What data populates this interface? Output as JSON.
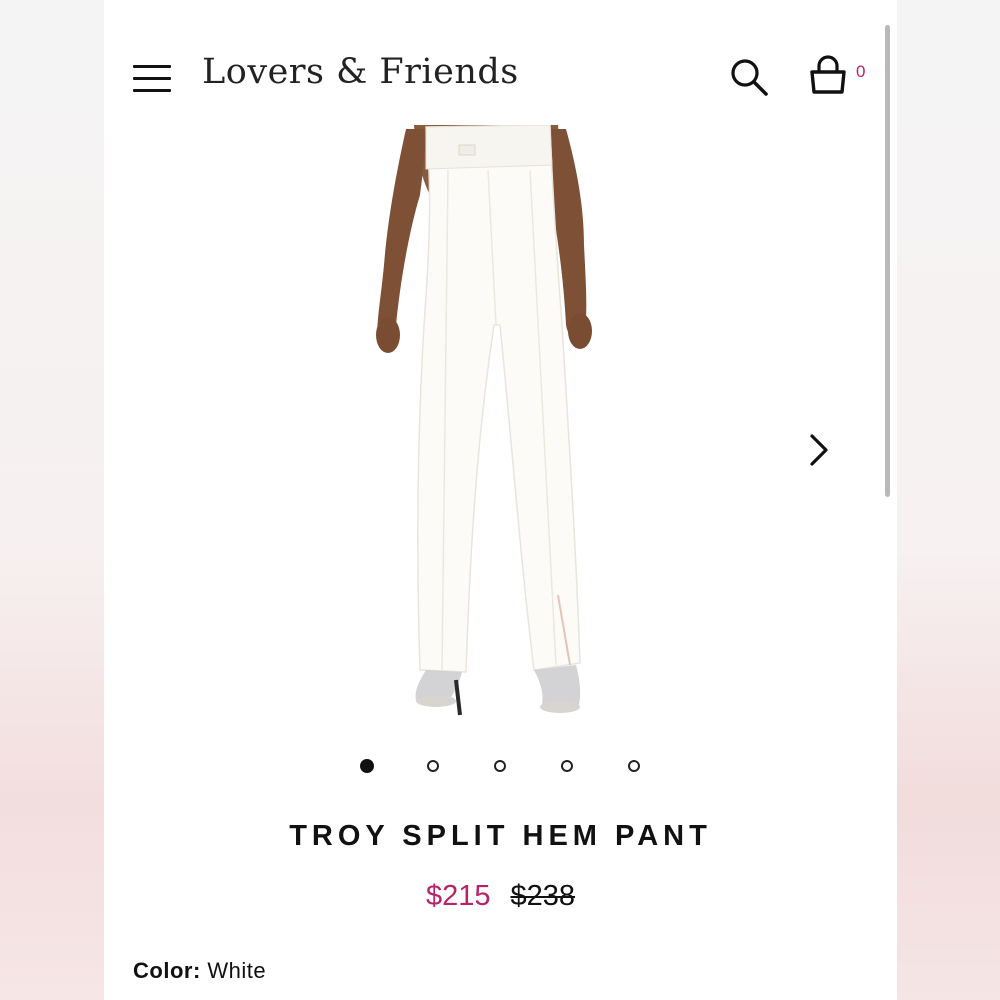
{
  "header": {
    "brand": "Lovers & Friends",
    "menu_icon": "hamburger-menu-icon",
    "search_icon": "search-icon",
    "bag_icon": "shopping-bag-icon",
    "bag_count": "0"
  },
  "gallery": {
    "image_description_icon": "product-photo",
    "total_images": 5,
    "active_index": 0,
    "next_icon": "chevron-right-icon"
  },
  "product": {
    "title": "TROY SPLIT HEM PANT",
    "sale_price": "$215",
    "original_price": "$238",
    "color_label": "Color:",
    "color_value": "White"
  },
  "colors": {
    "accent": "#b8246a",
    "text": "#111111",
    "page": "#ffffff"
  }
}
